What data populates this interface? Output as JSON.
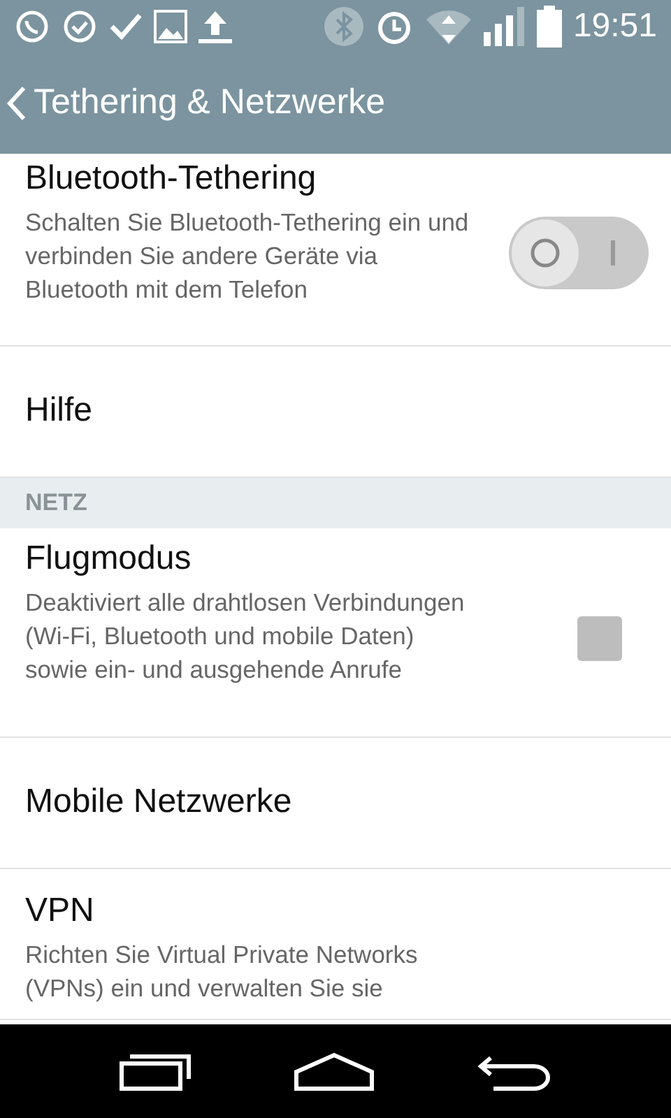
{
  "status_bar": {
    "time": "19:51"
  },
  "header": {
    "title": "Tethering & Netzwerke"
  },
  "items": [
    {
      "kind": "switch",
      "title": "Bluetooth-Tethering",
      "description": "Schalten Sie Bluetooth-Tethering ein und verbinden Sie andere Geräte via Bluetooth mit dem Telefon",
      "on": false
    },
    {
      "kind": "plain",
      "title": "Hilfe"
    },
    {
      "kind": "section",
      "title": "NETZ"
    },
    {
      "kind": "checkbox",
      "title": "Flugmodus",
      "description": "Deaktiviert alle drahtlosen Verbindungen (Wi-Fi, Bluetooth und mobile Daten) sowie ein- und ausgehende Anrufe",
      "checked": false
    },
    {
      "kind": "plain",
      "title": "Mobile Netzwerke"
    },
    {
      "kind": "text",
      "title": "VPN",
      "description": "Richten Sie Virtual Private Networks (VPNs) ein und verwalten Sie sie"
    }
  ]
}
